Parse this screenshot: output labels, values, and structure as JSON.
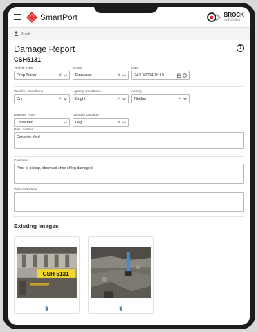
{
  "app": {
    "title": "SmartPort",
    "brand_name": "BROCK",
    "brand_sub": "solutions"
  },
  "user": {
    "name": "Brock"
  },
  "page": {
    "title": "Damage Report",
    "report_id": "CSH5131",
    "help_icon": "question-circle-icon"
  },
  "fields": {
    "vehicle_type": {
      "label": "Vehicle Type",
      "value": "Drop Trailer"
    },
    "vessel": {
      "label": "Vessel",
      "value": "Finnwave"
    },
    "date": {
      "label": "Date",
      "value": "24/10/2024 16:19"
    },
    "weather": {
      "label": "Weather Conditions",
      "value": "Dry"
    },
    "lighting": {
      "label": "Lighting Conditions",
      "value": "Bright"
    },
    "activity": {
      "label": "Activity",
      "value": "Neither"
    },
    "damage_type": {
      "label": "Damage Type",
      "value": "Observed"
    },
    "damage_location": {
      "label": "Damage Location",
      "value": "Leg"
    },
    "port_location": {
      "label": "Port Location",
      "value": "Concrete Yard"
    },
    "comment": {
      "label": "Comment",
      "value": "Prior to pickup, observed shoe of leg damaged"
    },
    "witness": {
      "label": "Witness Details",
      "value": ""
    }
  },
  "images": {
    "title": "Existing Images",
    "items": [
      {
        "plate_text": "CSH 5131"
      },
      {
        "plate_text": ""
      }
    ]
  },
  "icons": {
    "clear": "×",
    "menu": "hamburger-icon",
    "calendar": "calendar-icon",
    "clock": "clock-icon",
    "trash": "trash-icon"
  },
  "colors": {
    "accent": "#d9363e",
    "brand_red": "#e02a2a"
  }
}
